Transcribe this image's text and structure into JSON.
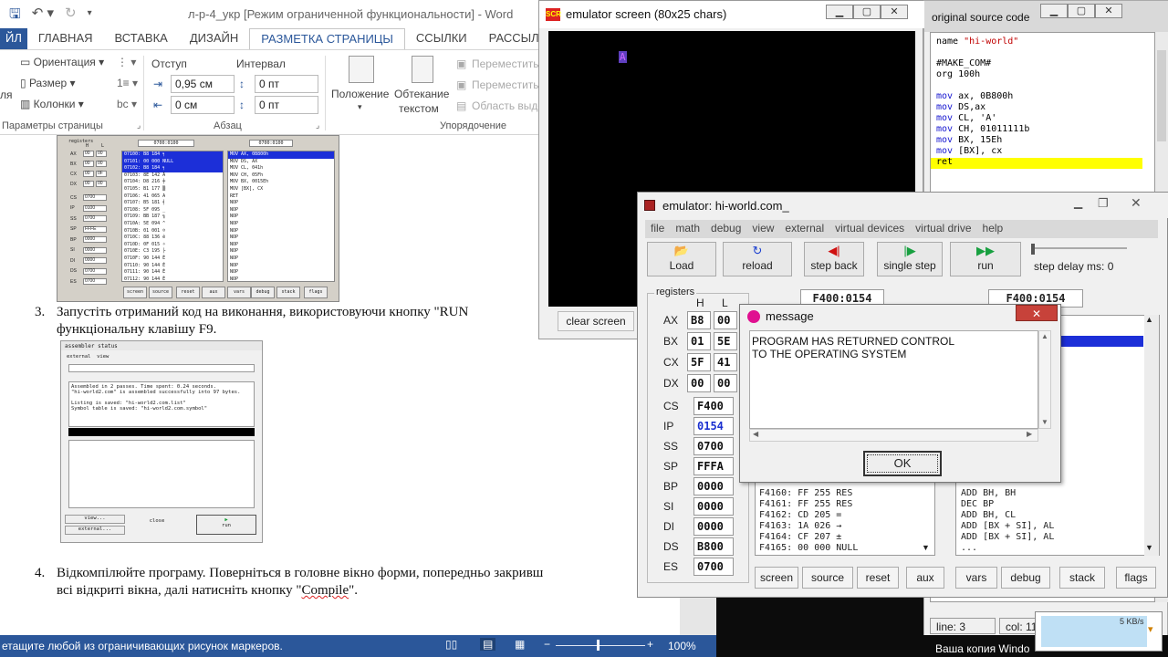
{
  "word": {
    "title": "л-р-4_укр [Режим ограниченной функциональности] - Word",
    "tabs": [
      "ЙЛ",
      "ГЛАВНАЯ",
      "ВСТАВКА",
      "ДИЗАЙН",
      "РАЗМЕТКА СТРАНИЦЫ",
      "ССЫЛКИ",
      "РАССЫЛКИ"
    ],
    "ribbon": {
      "orientation": "Ориентация",
      "size": "Размер",
      "columns": "Колонки",
      "indent_label": "Отступ",
      "indent_left": "0,95 см",
      "indent_right": "0 см",
      "spacing_label": "Интервал",
      "spacing_before": "0 пт",
      "spacing_after": "0 пт",
      "position": "Положение",
      "wrap_l1": "Обтекание",
      "wrap_l2": "текстом",
      "move_forward": "Переместить",
      "move_back": "Переместить",
      "selection_pane": "Область выде",
      "group_page_setup": "Параметры страницы",
      "group_paragraph": "Абзац",
      "group_arrange": "Упорядочение",
      "partial_left": "ля"
    },
    "body": {
      "step3_num": "3.",
      "step3_line1": "Запустіть отриманий код на виконання, використовуючи кнопку \"RUN",
      "step3_line2": "функціональну клавішу F9.",
      "step4_num": "4.",
      "step4_line1": "Відкомпілюйте програму. Поверніться в головне вікно форми, попередньо закривш",
      "step4_line2_pre": "всі відкриті вікна, далі натисніть кнопку \"",
      "step4_line2_word": "Compile",
      "step4_line2_post": "\"."
    },
    "shot1": {
      "regs_title": "registers",
      "addr1": "0700:0100",
      "addr2": "0700:0100",
      "regs": [
        {
          "n": "AX",
          "h": "00",
          "l": "00"
        },
        {
          "n": "BX",
          "h": "00",
          "l": "00"
        },
        {
          "n": "CX",
          "h": "00",
          "l": "0F"
        },
        {
          "n": "DX",
          "h": "00",
          "l": "00"
        },
        {
          "n": "CS",
          "v": "0700"
        },
        {
          "n": "IP",
          "v": "0100"
        },
        {
          "n": "SS",
          "v": "0700"
        },
        {
          "n": "SP",
          "v": "FFFE"
        },
        {
          "n": "BP",
          "v": "0000"
        },
        {
          "n": "SI",
          "v": "0000"
        },
        {
          "n": "DI",
          "v": "0000"
        },
        {
          "n": "DS",
          "v": "0700"
        },
        {
          "n": "ES",
          "v": "0700"
        }
      ],
      "mem": [
        "07100: B8 184 ╕",
        "07101: 00 000 NULL",
        "07102: B8 184 ╕",
        "07103: 8E 142 Ä",
        "07104: D8 216 ╪",
        "07105: B1 177 ▒",
        "07106: 41 065 A",
        "07107: B5 181 ╡",
        "07108: 5F 095 _",
        "07109: BB 187 ╗",
        "0710A: 5E 094 ^",
        "0710B: 01 001 ☺",
        "0710C: 88 136 ê",
        "0710D: 0F 015 ☼",
        "0710E: C3 195 ├",
        "0710F: 90 144 É",
        "07110: 90 144 É",
        "07111: 90 144 É",
        "07112: 90 144 É",
        "07113: 90 144 É",
        "07114: 90 144 É",
        "07115: 90 144 É"
      ],
      "dis": [
        "MOV AX, 0B800h",
        "MOV DS, AX",
        "MOV CL, 041h",
        "MOV CH, 05Fh",
        "MOV BX, 0015Eh",
        "MOV [BX], CX",
        "RET",
        "NOP",
        "NOP",
        "NOP",
        "NOP",
        "NOP",
        "NOP",
        "NOP",
        "NOP",
        "NOP",
        "NOP",
        "NOP",
        "NOP",
        "NOP",
        "NOP",
        "..."
      ],
      "buttons": [
        "screen",
        "source",
        "reset",
        "aux",
        "vars",
        "debug",
        "stack",
        "flags"
      ]
    },
    "shot2": {
      "title": "assembler status",
      "menu": [
        "external",
        "view"
      ],
      "line1": "Assembled in 2 passes. Time spent: 0.24 seconds.",
      "line2": "\"hi-world2.com\" is assembled successfully into 97 bytes.",
      "line3": "Listing is saved: \"hi-world2.com.list\"",
      "line4": "Symbol table is saved: \"hi-world2.com.symbol\"",
      "btn_view": "view...",
      "btn_external": "external...",
      "btn_close": "close",
      "btn_run": "run"
    },
    "status": {
      "hint": "етащите любой из ограничивающих рисунок маркеров.",
      "zoom": "100%"
    }
  },
  "emu_screen": {
    "title": "emulator screen (80x25 chars)",
    "char": "A",
    "char_color": "#cc66ff",
    "clear_btn": "clear screen"
  },
  "source": {
    "title": "original source code",
    "lines": [
      {
        "a": "name ",
        "b": "\"hi-world\"",
        "t": "str"
      },
      {
        "a": "",
        "b": "",
        "t": ""
      },
      {
        "a": "#MAKE_COM#",
        "b": "",
        "t": ""
      },
      {
        "a": "org 100h",
        "b": "",
        "t": ""
      },
      {
        "a": "",
        "b": "",
        "t": ""
      },
      {
        "a": "mov ",
        "b": "ax, 0B800h",
        "t": "kw"
      },
      {
        "a": "mov ",
        "b": "DS,ax",
        "t": "kw"
      },
      {
        "a": "mov ",
        "b": "CL, 'A'",
        "t": "kw"
      },
      {
        "a": "mov ",
        "b": "CH, 01011111b",
        "t": "kw"
      },
      {
        "a": "mov ",
        "b": "BX, 15Eh",
        "t": "kw"
      },
      {
        "a": "mov ",
        "b": "[BX], cx",
        "t": "kw"
      },
      {
        "a": "ret",
        "b": "",
        "t": "hl"
      }
    ],
    "line_label": "line: 3",
    "col_label": "col: 11"
  },
  "emulator": {
    "title": "emulator: hi-world.com_",
    "menu": [
      "file",
      "math",
      "debug",
      "view",
      "external",
      "virtual devices",
      "virtual drive",
      "help"
    ],
    "toolbar": {
      "load": "Load",
      "reload": "reload",
      "step_back": "step back",
      "single_step": "single step",
      "run": "run",
      "delay": "step delay ms: 0"
    },
    "registers_title": "registers",
    "h": "H",
    "l": "L",
    "regs8": [
      {
        "n": "AX",
        "h": "B8",
        "l": "00"
      },
      {
        "n": "BX",
        "h": "01",
        "l": "5E"
      },
      {
        "n": "CX",
        "h": "5F",
        "l": "41"
      },
      {
        "n": "DX",
        "h": "00",
        "l": "00"
      }
    ],
    "regs16": [
      {
        "n": "CS",
        "v": "F400"
      },
      {
        "n": "IP",
        "v": "0154"
      },
      {
        "n": "SS",
        "v": "0700"
      },
      {
        "n": "SP",
        "v": "FFFA"
      },
      {
        "n": "BP",
        "v": "0000"
      },
      {
        "n": "SI",
        "v": "0000"
      },
      {
        "n": "DI",
        "v": "0000"
      },
      {
        "n": "DS",
        "v": "B800"
      },
      {
        "n": "ES",
        "v": "0700"
      }
    ],
    "addr_left": "F400:0154",
    "addr_right": "F400:0154",
    "mem": [
      "F4160: FF 255 RES",
      "F4161: FF 255 RES",
      "F4162: CD 205 =",
      "F4163: 1A 026 →",
      "F4164: CF 207 ±",
      "F4165: 00 000 NULL"
    ],
    "dis": [
      "ADD BH, BH",
      "DEC BP",
      "ADD BH, CL",
      "ADD [BX + SI], AL",
      "ADD [BX + SI], AL",
      "..."
    ],
    "bottom": [
      "screen",
      "source",
      "reset",
      "aux",
      "vars",
      "debug",
      "stack",
      "flags"
    ]
  },
  "message": {
    "title": "message",
    "line1": "PROGRAM HAS RETURNED CONTROL",
    "line2": "TO THE OPERATING SYSTEM",
    "ok": "OK"
  },
  "taskbar": {
    "activation": "Ваша копия Windo",
    "speed": "5 KB/s"
  }
}
